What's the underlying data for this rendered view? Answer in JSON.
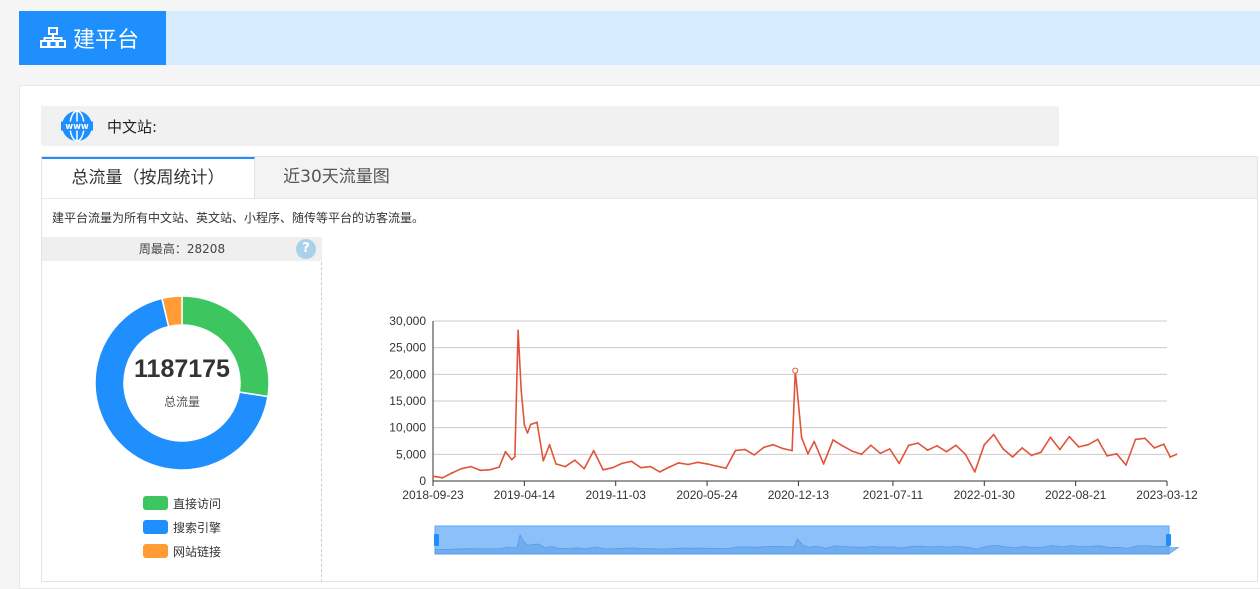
{
  "app": {
    "title": "建平台",
    "title_icon": "sitemap-icon"
  },
  "site": {
    "label": "中文站:",
    "icon": "www-globe-icon"
  },
  "tabs": [
    {
      "label": "总流量（按周统计）",
      "active": true
    },
    {
      "label": "近30天流量图",
      "active": false
    }
  ],
  "description": "建平台流量为所有中文站、英文站、小程序、随传等平台的访客流量。",
  "summary": {
    "week_peak": "周最高：28208",
    "help": "?",
    "total": "1187175",
    "total_label": "总流量"
  },
  "donut": {
    "segments": [
      {
        "name": "直接访问",
        "value": 0.275,
        "color": "#3dc55f"
      },
      {
        "name": "搜索引擎",
        "value": 0.688,
        "color": "#1e8ffd"
      },
      {
        "name": "网站链接",
        "value": 0.037,
        "color": "#ff9c33"
      }
    ]
  },
  "colors": {
    "accent": "#1e8ffd",
    "line": "#e1543a",
    "slider_fill": "#8cc0f9"
  },
  "chart_data": {
    "type": "line",
    "y_ticks": [
      "30,000",
      "25,000",
      "20,000",
      "15,000",
      "10,000",
      "5,000",
      "0"
    ],
    "x_ticks": [
      "2018-09-23",
      "2019-04-14",
      "2019-11-03",
      "2020-05-24",
      "2020-12-13",
      "2021-07-11",
      "2022-01-30",
      "2022-08-21",
      "2023-03-12"
    ],
    "ylim": [
      0,
      30000
    ],
    "grid": true,
    "zoom_slider": true,
    "series": [
      {
        "points": [
          [
            "2018-09-23",
            900
          ],
          [
            "2018-10-14",
            600
          ],
          [
            "2018-11-04",
            1500
          ],
          [
            "2018-11-25",
            2300
          ],
          [
            "2018-12-16",
            2700
          ],
          [
            "2019-01-06",
            2000
          ],
          [
            "2019-01-27",
            2100
          ],
          [
            "2019-02-17",
            2600
          ],
          [
            "2019-03-03",
            5500
          ],
          [
            "2019-03-17",
            4000
          ],
          [
            "2019-03-24",
            4600
          ],
          [
            "2019-03-31",
            28208
          ],
          [
            "2019-04-07",
            17000
          ],
          [
            "2019-04-14",
            10500
          ],
          [
            "2019-04-21",
            9000
          ],
          [
            "2019-04-28",
            10600
          ],
          [
            "2019-05-12",
            11000
          ],
          [
            "2019-05-26",
            3800
          ],
          [
            "2019-06-09",
            6800
          ],
          [
            "2019-06-23",
            3200
          ],
          [
            "2019-07-14",
            2700
          ],
          [
            "2019-08-04",
            3900
          ],
          [
            "2019-08-25",
            2300
          ],
          [
            "2019-09-15",
            5700
          ],
          [
            "2019-10-06",
            2100
          ],
          [
            "2019-10-27",
            2500
          ],
          [
            "2019-11-17",
            3300
          ],
          [
            "2019-12-08",
            3700
          ],
          [
            "2019-12-29",
            2500
          ],
          [
            "2020-01-19",
            2700
          ],
          [
            "2020-02-09",
            1700
          ],
          [
            "2020-03-01",
            2600
          ],
          [
            "2020-03-22",
            3400
          ],
          [
            "2020-04-12",
            3100
          ],
          [
            "2020-05-03",
            3500
          ],
          [
            "2020-05-24",
            3200
          ],
          [
            "2020-06-14",
            2800
          ],
          [
            "2020-07-05",
            2400
          ],
          [
            "2020-07-26",
            5700
          ],
          [
            "2020-08-16",
            5900
          ],
          [
            "2020-09-06",
            4900
          ],
          [
            "2020-09-27",
            6300
          ],
          [
            "2020-10-18",
            6800
          ],
          [
            "2020-11-08",
            6100
          ],
          [
            "2020-11-29",
            5700
          ],
          [
            "2020-12-06",
            20700
          ],
          [
            "2020-12-20",
            8200
          ],
          [
            "2021-01-03",
            5100
          ],
          [
            "2021-01-17",
            7400
          ],
          [
            "2021-02-07",
            3200
          ],
          [
            "2021-02-28",
            7700
          ],
          [
            "2021-03-21",
            6600
          ],
          [
            "2021-04-11",
            5600
          ],
          [
            "2021-05-02",
            5000
          ],
          [
            "2021-05-23",
            6700
          ],
          [
            "2021-06-13",
            5200
          ],
          [
            "2021-07-04",
            6000
          ],
          [
            "2021-07-25",
            3300
          ],
          [
            "2021-08-15",
            6700
          ],
          [
            "2021-09-05",
            7100
          ],
          [
            "2021-09-26",
            5800
          ],
          [
            "2021-10-17",
            6600
          ],
          [
            "2021-11-07",
            5500
          ],
          [
            "2021-11-28",
            6700
          ],
          [
            "2021-12-19",
            5000
          ],
          [
            "2022-01-09",
            1700
          ],
          [
            "2022-01-30",
            6800
          ],
          [
            "2022-02-20",
            8700
          ],
          [
            "2022-03-13",
            6000
          ],
          [
            "2022-04-03",
            4500
          ],
          [
            "2022-04-24",
            6200
          ],
          [
            "2022-05-15",
            4800
          ],
          [
            "2022-06-05",
            5400
          ],
          [
            "2022-06-26",
            8200
          ],
          [
            "2022-07-17",
            5900
          ],
          [
            "2022-08-07",
            8300
          ],
          [
            "2022-08-28",
            6400
          ],
          [
            "2022-09-18",
            6800
          ],
          [
            "2022-10-09",
            7800
          ],
          [
            "2022-10-30",
            4700
          ],
          [
            "2022-11-20",
            5100
          ],
          [
            "2022-12-11",
            3000
          ],
          [
            "2023-01-01",
            7800
          ],
          [
            "2023-01-22",
            8000
          ],
          [
            "2023-02-12",
            6200
          ],
          [
            "2023-03-05",
            6900
          ],
          [
            "2023-03-19",
            4500
          ],
          [
            "2023-04-02",
            5000
          ]
        ]
      }
    ]
  }
}
